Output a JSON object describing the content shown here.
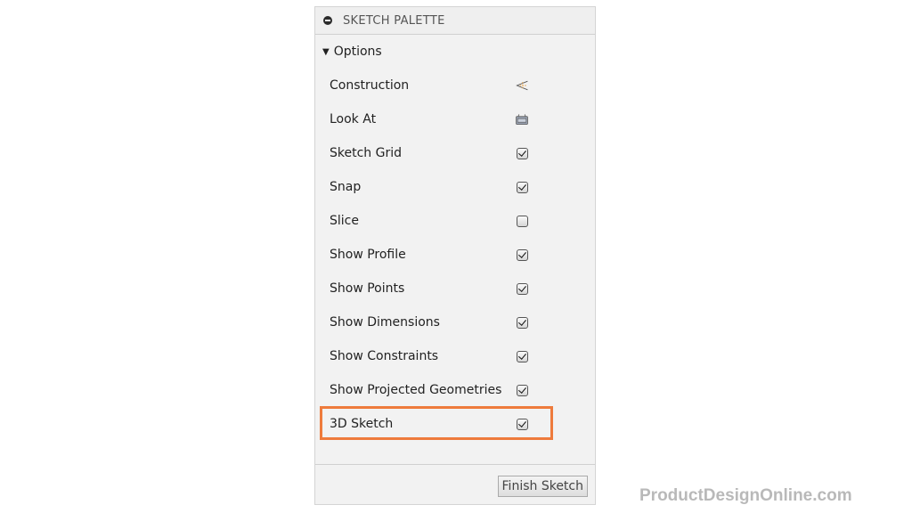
{
  "palette": {
    "title": "SKETCH PALETTE",
    "section": "Options",
    "rows": [
      {
        "label": "Construction",
        "control": "construction-icon"
      },
      {
        "label": "Look At",
        "control": "look-at-icon"
      },
      {
        "label": "Sketch Grid",
        "control": "checkbox",
        "checked": true
      },
      {
        "label": "Snap",
        "control": "checkbox",
        "checked": true
      },
      {
        "label": "Slice",
        "control": "checkbox",
        "checked": false
      },
      {
        "label": "Show Profile",
        "control": "checkbox",
        "checked": true
      },
      {
        "label": "Show Points",
        "control": "checkbox",
        "checked": true
      },
      {
        "label": "Show Dimensions",
        "control": "checkbox",
        "checked": true
      },
      {
        "label": "Show Constraints",
        "control": "checkbox",
        "checked": true
      },
      {
        "label": "Show Projected Geometries",
        "control": "checkbox",
        "checked": true
      },
      {
        "label": "3D Sketch",
        "control": "checkbox",
        "checked": true,
        "highlighted": true
      }
    ],
    "finish_button": "Finish Sketch",
    "highlight_color": "#ee7b3c"
  },
  "watermark": "ProductDesignOnline.com"
}
